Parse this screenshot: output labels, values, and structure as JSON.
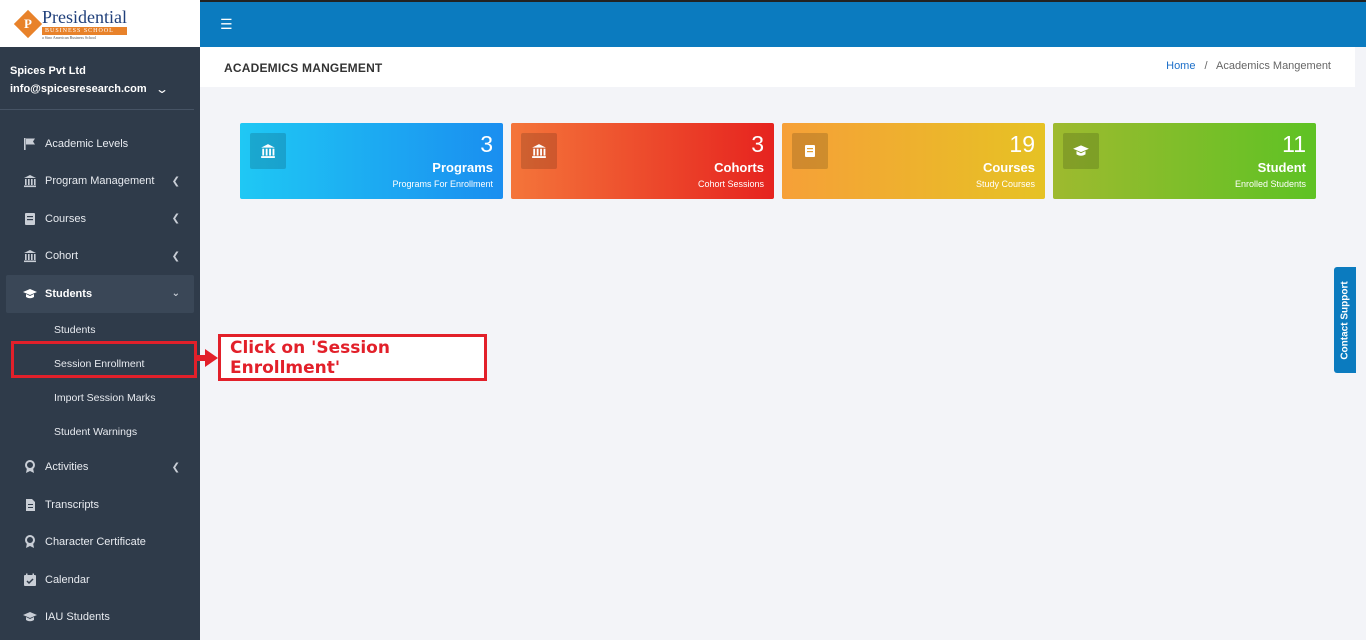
{
  "brand": {
    "mark": "P",
    "title": "Presidential",
    "subtitle": "BUSINESS SCHOOL",
    "tagline": "a Sino American Business School"
  },
  "profile": {
    "org": "Spices Pvt Ltd",
    "email": "info@spicesresearch.com"
  },
  "sidebar": {
    "items": [
      {
        "label": "Academic Levels",
        "icon": "flag-icon"
      },
      {
        "label": "Program Management",
        "icon": "institution-icon"
      },
      {
        "label": "Courses",
        "icon": "courses-icon"
      },
      {
        "label": "Cohort",
        "icon": "institution-icon"
      },
      {
        "label": "Students",
        "icon": "graduation-cap-icon"
      },
      {
        "label": "Activities",
        "icon": "award-icon"
      },
      {
        "label": "Transcripts",
        "icon": "document-icon"
      },
      {
        "label": "Character Certificate",
        "icon": "award-icon"
      },
      {
        "label": "Calendar",
        "icon": "calendar-check-icon"
      },
      {
        "label": "IAU Students",
        "icon": "graduation-cap-icon"
      }
    ],
    "students_sub": [
      {
        "label": "Students"
      },
      {
        "label": "Session Enrollment"
      },
      {
        "label": "Import Session Marks"
      },
      {
        "label": "Student Warnings"
      }
    ]
  },
  "header": {
    "page_title": "ACADEMICS MANGEMENT",
    "breadcrumb_home": "Home",
    "breadcrumb_sep": "/",
    "breadcrumb_current": "Academics Mangement"
  },
  "cards": [
    {
      "number": "3",
      "label": "Programs",
      "desc": "Programs For Enrollment",
      "color": "#1a8ef0"
    },
    {
      "number": "3",
      "label": "Cohorts",
      "desc": "Cohort Sessions",
      "color": "#e6231f"
    },
    {
      "number": "19",
      "label": "Courses",
      "desc": "Study Courses",
      "color": "#e6c224"
    },
    {
      "number": "11",
      "label": "Student",
      "desc": "Enrolled Students",
      "color": "#5ec224"
    }
  ],
  "annotation": {
    "text": "Click on 'Session Enrollment'",
    "color": "#e2202a"
  },
  "contact_support": "Contact Support"
}
